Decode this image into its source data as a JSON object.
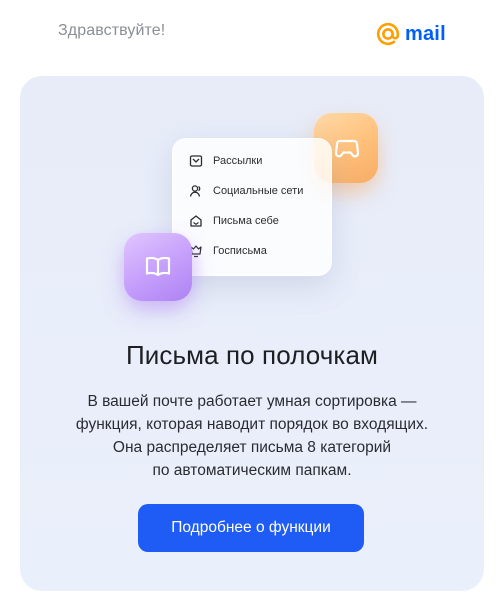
{
  "header": {
    "greeting": "Здравствуйте!",
    "logo_text": "mail",
    "logo_color": "#005ff9",
    "logo_accent": "#ff9e00"
  },
  "promo": {
    "menu_items": [
      {
        "label": "Рассылки",
        "icon": "newsletter-icon"
      },
      {
        "label": "Социальные сети",
        "icon": "social-networks-icon"
      },
      {
        "label": "Письма себе",
        "icon": "letters-to-self-icon"
      },
      {
        "label": "Госписьма",
        "icon": "government-letters-icon"
      }
    ],
    "tiles": [
      {
        "name": "games-tile",
        "icon": "gamepad-icon",
        "color": "#ffc07a"
      },
      {
        "name": "education-tile",
        "icon": "book-icon",
        "color": "#c59dfb"
      }
    ],
    "title": "Письма по полочкам",
    "description_lines": [
      "В вашей почте работает умная сортировка —",
      "функция, которая наводит порядок во входящих.",
      "Она распределяет письма 8 категорий",
      "по автоматическим папкам."
    ],
    "cta_label": "Подробнее о функции",
    "cta_color": "#1f5cf6"
  }
}
